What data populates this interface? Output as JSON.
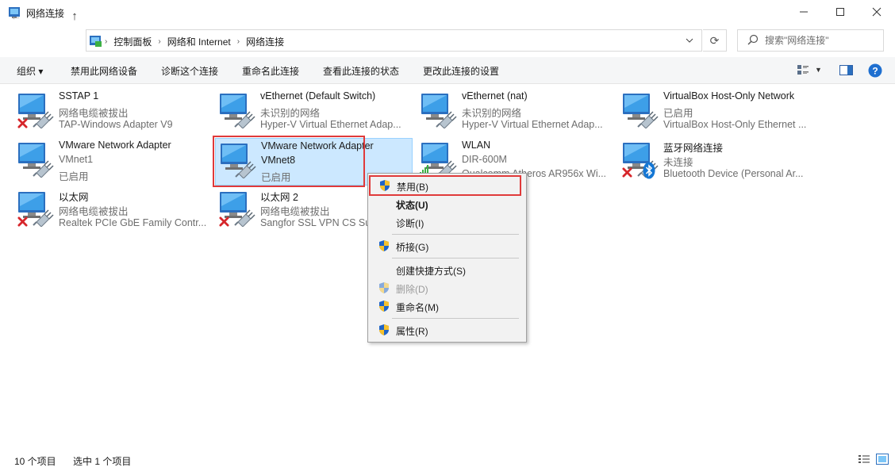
{
  "window": {
    "title": "网络连接"
  },
  "nav": {
    "back": "←",
    "forward": "→",
    "recent": "⌄",
    "up": "↑",
    "breadcrumbs": [
      "控制面板",
      "网络和 Internet",
      "网络连接"
    ],
    "refresh": "⟳"
  },
  "search": {
    "placeholder": "搜索\"网络连接\""
  },
  "toolbar": {
    "organize": "组织 ▾",
    "disable": "禁用此网络设备",
    "diagnose": "诊断这个连接",
    "rename": "重命名此连接",
    "status": "查看此连接的状态",
    "change": "更改此连接的设置"
  },
  "colors": {
    "selection": "#cce8ff",
    "highlight_border": "#e03a3a",
    "accent": "#0078d7"
  },
  "connections": [
    {
      "name": "SSTAP 1",
      "status": "网络电缆被拔出",
      "device": "TAP-Windows Adapter V9",
      "badge": "x"
    },
    {
      "name": "vEthernet (Default Switch)",
      "status": "未识别的网络",
      "device": "Hyper-V Virtual Ethernet Adap...",
      "badge": "none"
    },
    {
      "name": "vEthernet (nat)",
      "status": "未识别的网络",
      "device": "Hyper-V Virtual Ethernet Adap...",
      "badge": "none"
    },
    {
      "name": "VirtualBox Host-Only Network",
      "status": "已启用",
      "device": "VirtualBox Host-Only Ethernet ...",
      "badge": "none"
    },
    {
      "name": "VMware Network Adapter",
      "status": "VMnet1",
      "device": "已启用",
      "badge": "none"
    },
    {
      "name": "VMware Network Adapter",
      "status": "VMnet8",
      "device": "已启用",
      "badge": "none",
      "selected": true
    },
    {
      "name": "WLAN",
      "status": "DIR-600M",
      "device": "Qualcomm Atheros AR956x Wi...",
      "badge": "wifi"
    },
    {
      "name": "蓝牙网络连接",
      "status": "未连接",
      "device": "Bluetooth Device (Personal Ar...",
      "badge": "x-bluetooth"
    },
    {
      "name": "以太网",
      "status": "网络电缆被拔出",
      "device": "Realtek PCIe GbE Family Contr...",
      "badge": "x"
    },
    {
      "name": "以太网 2",
      "status": "网络电缆被拔出",
      "device": "Sangfor SSL VPN CS Support ...",
      "badge": "x"
    }
  ],
  "context_menu": [
    {
      "label": "禁用(B)",
      "shield": true,
      "style": "normal",
      "highlighted": true
    },
    {
      "label": "状态(U)",
      "shield": false,
      "style": "bold"
    },
    {
      "label": "诊断(I)",
      "shield": false,
      "style": "normal"
    },
    {
      "label": "桥接(G)",
      "shield": true,
      "style": "normal"
    },
    {
      "label": "创建快捷方式(S)",
      "shield": false,
      "style": "normal"
    },
    {
      "label": "删除(D)",
      "shield": true,
      "style": "disabled"
    },
    {
      "label": "重命名(M)",
      "shield": true,
      "style": "normal"
    },
    {
      "label": "属性(R)",
      "shield": true,
      "style": "normal"
    }
  ],
  "statusbar": {
    "count": "10 个项目",
    "selected": "选中 1 个项目"
  },
  "icons": [
    "app-icon",
    "back-icon",
    "forward-icon",
    "up-icon",
    "refresh-icon",
    "search-icon",
    "view-options-icon",
    "preview-pane-icon",
    "help-icon",
    "network-adapter-icon",
    "red-x-icon",
    "wifi-signal-icon",
    "bluetooth-icon",
    "uac-shield-icon",
    "details-view-icon",
    "tiles-view-icon"
  ]
}
